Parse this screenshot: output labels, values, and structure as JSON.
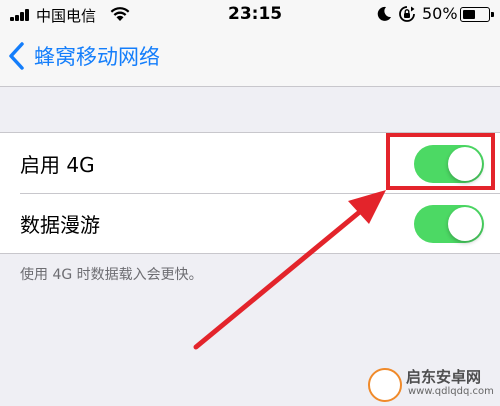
{
  "status_bar": {
    "carrier": "中国电信",
    "time": "23:15",
    "battery_percent": "50%",
    "battery_level": 0.5,
    "icons": [
      "signal-icon",
      "wifi-icon",
      "moon-icon",
      "rotation-lock-icon",
      "battery-icon"
    ]
  },
  "nav": {
    "back_label": "蜂窝移动网络",
    "back_icon": "chevron-left-icon"
  },
  "settings": {
    "rows": [
      {
        "label": "启用 4G",
        "enabled": true
      },
      {
        "label": "数据漫游",
        "enabled": true
      }
    ],
    "footer": "使用 4G 时数据载入会更快。"
  },
  "colors": {
    "accent": "#147efb",
    "toggle_on": "#4cd964",
    "annotation": "#e3242b",
    "background": "#efeff4"
  },
  "watermark": {
    "name": "启东安卓网",
    "url": "www.qdlqdq.com"
  }
}
